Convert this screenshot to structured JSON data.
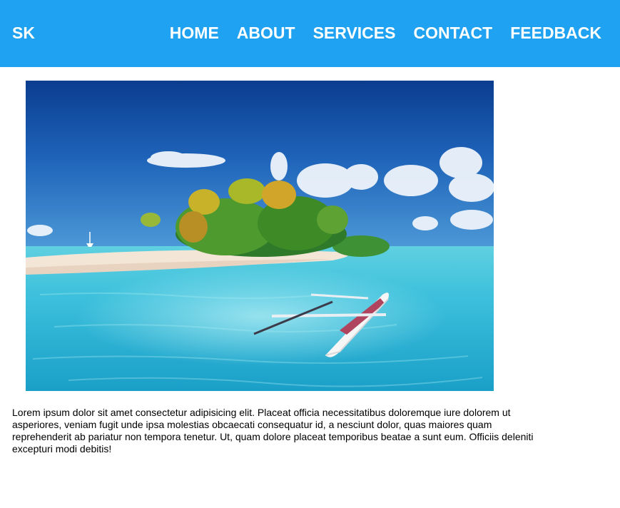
{
  "header": {
    "brand": "SK",
    "background_color": "#1fa2f1",
    "nav": [
      {
        "label": "HOME"
      },
      {
        "label": "ABOUT"
      },
      {
        "label": "SERVICES"
      },
      {
        "label": "CONTACT"
      },
      {
        "label": "FEEDBACK"
      }
    ]
  },
  "hero": {
    "icon": "tropical-island-photo"
  },
  "content": {
    "paragraph": "Lorem ipsum dolor sit amet consectetur adipisicing elit. Placeat officia necessitatibus doloremque iure dolorem ut asperiores, veniam fugit unde ipsa molestias obcaecati consequatur id, a nesciunt dolor, quas maiores quam reprehenderit ab pariatur non tempora tenetur. Ut, quam dolore placeat temporibus beatae a sunt eum. Officiis deleniti excepturi modi debitis!"
  }
}
